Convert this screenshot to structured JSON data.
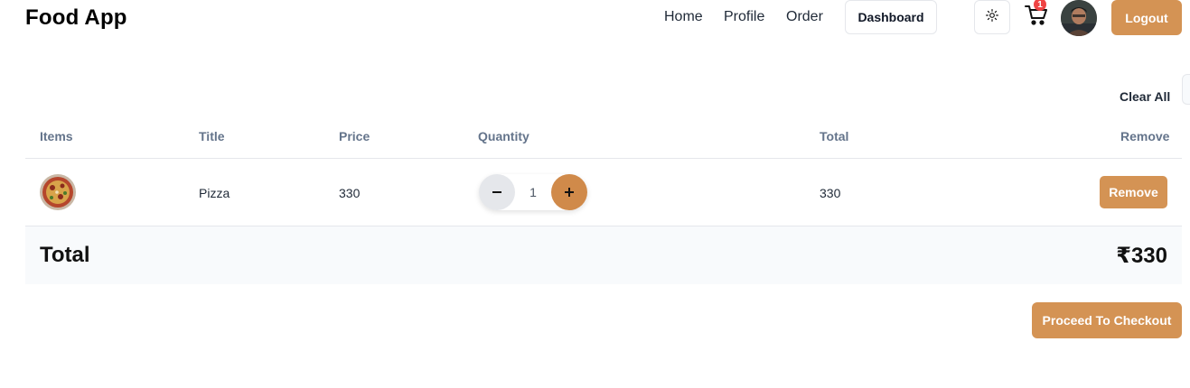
{
  "header": {
    "brand": "Food App",
    "nav": [
      "Home",
      "Profile",
      "Order"
    ],
    "dashboard_label": "Dashboard",
    "theme_icon": "sun-icon",
    "cart_icon": "cart-icon",
    "cart_count": "1",
    "logout_label": "Logout"
  },
  "cart": {
    "clear_all_label": "Clear All",
    "columns": [
      "Items",
      "Title",
      "Price",
      "Quantity",
      "Total",
      "Remove"
    ],
    "rows": [
      {
        "title": "Pizza",
        "price": "330",
        "quantity": "1",
        "total": "330",
        "remove_label": "Remove"
      }
    ],
    "total_label": "Total",
    "total_value": "₹330",
    "checkout_label": "Proceed To Checkout"
  },
  "colors": {
    "accent": "#d49354",
    "badge": "#ef4444",
    "header_text": "#64748b"
  }
}
